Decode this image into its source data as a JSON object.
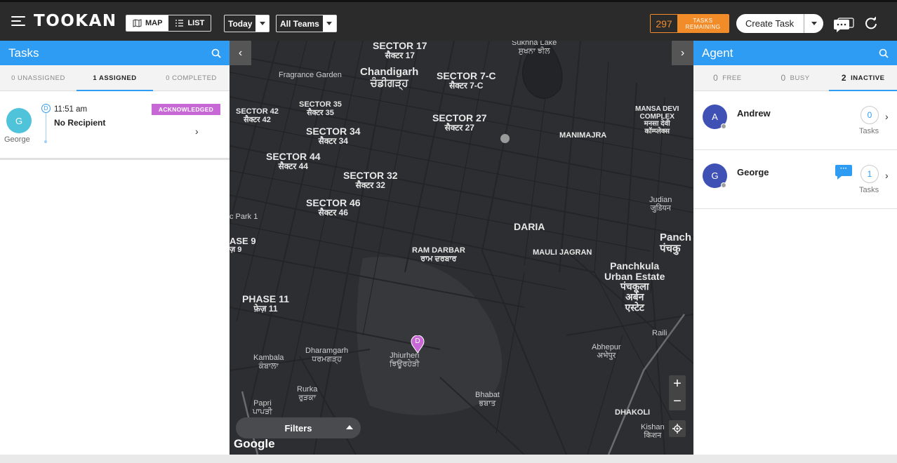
{
  "header": {
    "logo": "TOOKAN",
    "view_map": "MAP",
    "view_list": "LIST",
    "date_filter": "Today",
    "team_filter": "All Teams",
    "tasks_remaining_count": "297",
    "tasks_remaining_line1": "TASKS",
    "tasks_remaining_line2": "REMAINING",
    "create_task": "Create Task"
  },
  "tasks_panel": {
    "title": "Tasks",
    "tabs": [
      {
        "label": "0 UNASSIGNED"
      },
      {
        "label": "1 ASSIGNED"
      },
      {
        "label": "0 COMPLETED"
      }
    ],
    "task": {
      "avatar_letter": "G",
      "agent_name": "George",
      "type_marker": "D",
      "time": "11:51 am",
      "recipient": "No Recipient",
      "status": "ACKNOWLEDGED"
    }
  },
  "map": {
    "labels": {
      "s17": "SECTOR 17",
      "s17h": "सैक्टर 17",
      "sukhna": "Sukhna Lake",
      "sukhna_p": "ਸੁਖਨਾ ਝੀਲ",
      "fragrance": "Fragrance Garden",
      "chandigarh": "Chandigarh",
      "chandigarh_p": "ਚੰਡੀਗੜ੍ਹ",
      "s7c": "SECTOR 7-C",
      "s7ch": "सैक्टर 7-C",
      "s35": "SECTOR 35",
      "s35h": "सैक्टर 35",
      "s42": "SECTOR 42",
      "s42h": "सैक्टर 42",
      "s27": "SECTOR 27",
      "s27h": "सैक्टर 27",
      "s34": "SECTOR 34",
      "s34h": "सैक्टर 34",
      "manimajra": "MANIMAJRA",
      "mansa1": "MANSA DEVI",
      "mansa2": "COMPLEX",
      "mansa3": "मनसा देवी",
      "mansa4": "कॉम्प्लेक्स",
      "s44": "SECTOR 44",
      "s44h": "सैक्टर 44",
      "s32": "SECTOR 32",
      "s32h": "सैक्टर 32",
      "s46": "SECTOR 46",
      "s46h": "सैक्टर 46",
      "judian": "Judian",
      "judian_h": "जुडियन",
      "park1": "c Park 1",
      "daria": "DARIA",
      "panch": "Panch",
      "panch_h": "पंचकु",
      "phase9": "ASE 9",
      "phase9h": "ज़ 9",
      "ramdarbar": "RAM DARBAR",
      "ramdarbar_p": "ਰਾਮ ਦਰਬਾਰ",
      "mauli": "MAULI JAGRAN",
      "pku1": "Panchkula",
      "pku2": "Urban Estate",
      "pku3": "पंचकूला",
      "pku4": "अर्बन",
      "pku5": "एस्टेट",
      "phase11": "PHASE 11",
      "phase11h": "फ़ेज़ 11",
      "raili": "Raili",
      "dharamgarh": "Dharamgarh",
      "dharamgarh_p": "ਧਰਮਗੜ੍ਹ",
      "kambala": "Kambala",
      "kambala_p": "ਕੰਬਾਲਾ",
      "jhiurheri": "Jhiurheri",
      "jhiurheri_p": "ਝਿਊਰਹੇੜੀ",
      "abhepur": "Abhepur",
      "abhepur_h": "अभेपुर",
      "rurka": "Rurka",
      "rurka_p": "ਰੁੜਕਾ",
      "bhabat": "Bhabat",
      "bhabat_p": "ਭਬਾਤ",
      "papri": "Papri",
      "papri_p": "ਪਾਪੜੀ",
      "dhakoli": "DHAKOLI",
      "kishan": "Kishan",
      "kishan_h": "किशन"
    },
    "pin_letter": "D",
    "filters": "Filters",
    "google": "Google",
    "zoom_in": "+",
    "zoom_out": "−"
  },
  "agent_panel": {
    "title": "Agent",
    "tabs": [
      {
        "count": "0",
        "label": "FREE"
      },
      {
        "count": "0",
        "label": "BUSY"
      },
      {
        "count": "2",
        "label": "INACTIVE"
      }
    ],
    "agents": [
      {
        "letter": "A",
        "name": "Andrew",
        "tasks": "0",
        "tasks_label": "Tasks"
      },
      {
        "letter": "G",
        "name": "George",
        "tasks": "1",
        "tasks_label": "Tasks",
        "message": "···"
      }
    ]
  },
  "colors": {
    "accent": "#2f9cf3",
    "topbar": "#2b2b2b",
    "orange": "#f28c28",
    "acknowledged": "#c868d6",
    "map_bg": "#2d2e31",
    "avatar_task": "#4fc3d9",
    "avatar_agent": "#3f51b5"
  }
}
